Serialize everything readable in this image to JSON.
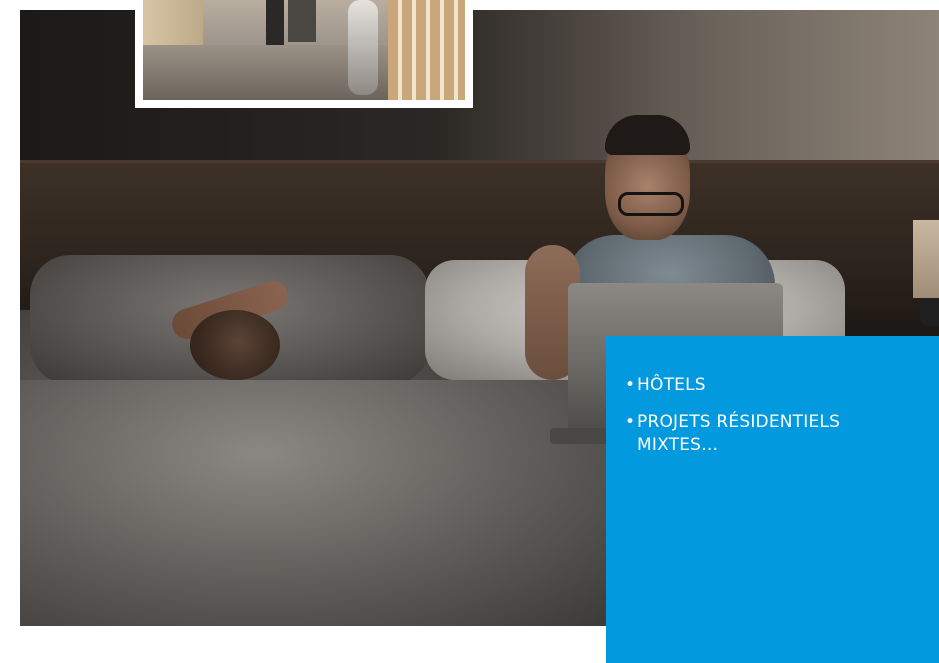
{
  "colors": {
    "panel_blue": "#0399de",
    "panel_text": "#ffffff",
    "page_background": "#ffffff"
  },
  "images": {
    "main_photo": "man-working-on-laptop-in-bed-hotel-room",
    "inset_photo": "hotel-corridor-traveler-with-suitcase"
  },
  "panel": {
    "bullet_symbol": "•",
    "items": [
      {
        "label": "HÔTELS"
      },
      {
        "label": "PROJETS RÉSIDENTIELS MIXTES…"
      }
    ]
  }
}
